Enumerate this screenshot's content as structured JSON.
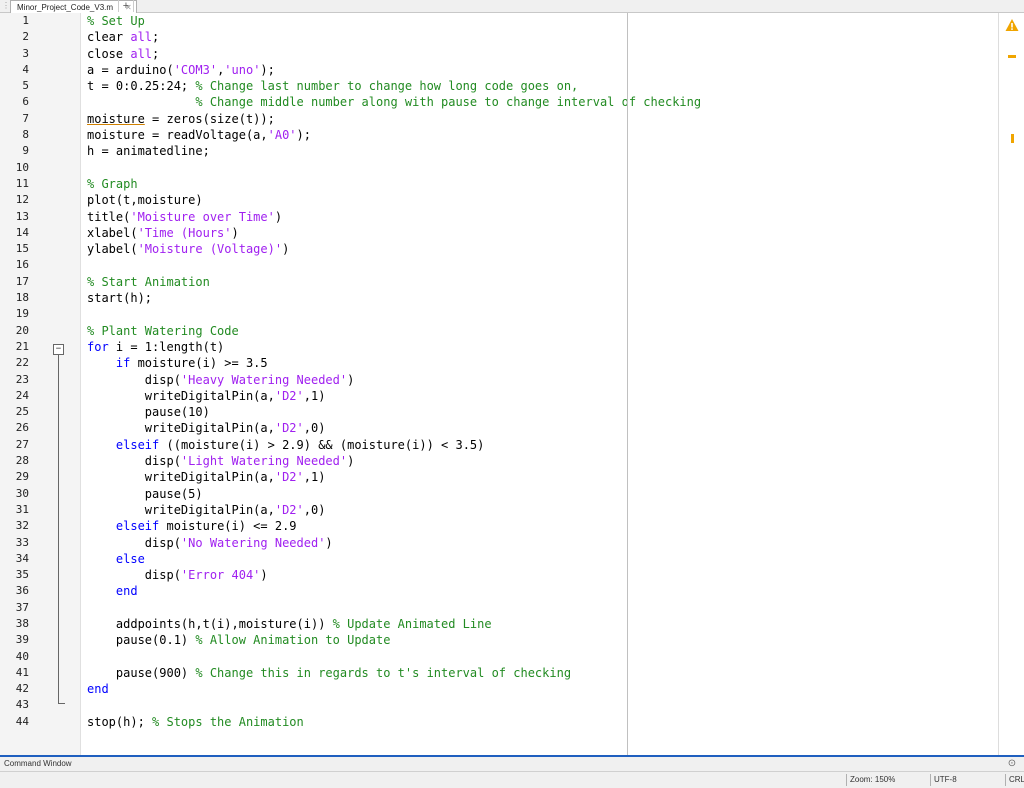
{
  "tab": {
    "title": "Minor_Project_Code_V3.m",
    "close": "✕",
    "add": "+"
  },
  "lines": [
    {
      "n": "1",
      "segs": [
        {
          "t": "% Set Up",
          "c": "cm"
        }
      ]
    },
    {
      "n": "2",
      "segs": [
        {
          "t": "clear ",
          "c": ""
        },
        {
          "t": "all",
          "c": "str"
        },
        {
          "t": ";",
          "c": ""
        }
      ]
    },
    {
      "n": "3",
      "segs": [
        {
          "t": "close ",
          "c": ""
        },
        {
          "t": "all",
          "c": "str"
        },
        {
          "t": ";",
          "c": ""
        }
      ]
    },
    {
      "n": "4",
      "segs": [
        {
          "t": "a = arduino(",
          "c": ""
        },
        {
          "t": "'COM3'",
          "c": "str"
        },
        {
          "t": ",",
          "c": ""
        },
        {
          "t": "'uno'",
          "c": "str"
        },
        {
          "t": ");",
          "c": ""
        }
      ]
    },
    {
      "n": "5",
      "segs": [
        {
          "t": "t = 0:0.25:24; ",
          "c": ""
        },
        {
          "t": "% Change last number to change how long code goes on,",
          "c": "cm"
        }
      ]
    },
    {
      "n": "6",
      "segs": [
        {
          "t": "               ",
          "c": ""
        },
        {
          "t": "% Change middle number along with pause to change interval of checking",
          "c": "cm"
        }
      ]
    },
    {
      "n": "7",
      "segs": [
        {
          "t": "moisture",
          "c": "ul"
        },
        {
          "t": " = zeros(size(t));",
          "c": ""
        }
      ]
    },
    {
      "n": "8",
      "segs": [
        {
          "t": "moisture = readVoltage(a,",
          "c": ""
        },
        {
          "t": "'A0'",
          "c": "str"
        },
        {
          "t": ");",
          "c": ""
        }
      ]
    },
    {
      "n": "9",
      "segs": [
        {
          "t": "h = animatedline;",
          "c": ""
        }
      ]
    },
    {
      "n": "10",
      "segs": []
    },
    {
      "n": "11",
      "segs": [
        {
          "t": "% Graph",
          "c": "cm"
        }
      ]
    },
    {
      "n": "12",
      "segs": [
        {
          "t": "plot(t,moisture)",
          "c": ""
        }
      ]
    },
    {
      "n": "13",
      "segs": [
        {
          "t": "title(",
          "c": ""
        },
        {
          "t": "'Moisture over Time'",
          "c": "str"
        },
        {
          "t": ")",
          "c": ""
        }
      ]
    },
    {
      "n": "14",
      "segs": [
        {
          "t": "xlabel(",
          "c": ""
        },
        {
          "t": "'Time (Hours'",
          "c": "str"
        },
        {
          "t": ")",
          "c": ""
        }
      ]
    },
    {
      "n": "15",
      "segs": [
        {
          "t": "ylabel(",
          "c": ""
        },
        {
          "t": "'Moisture (Voltage)'",
          "c": "str"
        },
        {
          "t": ")",
          "c": ""
        }
      ]
    },
    {
      "n": "16",
      "segs": []
    },
    {
      "n": "17",
      "segs": [
        {
          "t": "% Start Animation",
          "c": "cm"
        }
      ]
    },
    {
      "n": "18",
      "segs": [
        {
          "t": "start(h);",
          "c": ""
        }
      ]
    },
    {
      "n": "19",
      "segs": []
    },
    {
      "n": "20",
      "segs": [
        {
          "t": "% Plant Watering Code",
          "c": "cm"
        }
      ]
    },
    {
      "n": "21",
      "segs": [
        {
          "t": "for",
          "c": "kw"
        },
        {
          "t": " i = 1:length(t)",
          "c": ""
        }
      ]
    },
    {
      "n": "22",
      "segs": [
        {
          "t": "    ",
          "c": ""
        },
        {
          "t": "if",
          "c": "kw"
        },
        {
          "t": " moisture(i) >= 3.5",
          "c": ""
        }
      ]
    },
    {
      "n": "23",
      "segs": [
        {
          "t": "        disp(",
          "c": ""
        },
        {
          "t": "'Heavy Watering Needed'",
          "c": "str"
        },
        {
          "t": ")",
          "c": ""
        }
      ]
    },
    {
      "n": "24",
      "segs": [
        {
          "t": "        writeDigitalPin(a,",
          "c": ""
        },
        {
          "t": "'D2'",
          "c": "str"
        },
        {
          "t": ",1)",
          "c": ""
        }
      ]
    },
    {
      "n": "25",
      "segs": [
        {
          "t": "        pause(10)",
          "c": ""
        }
      ]
    },
    {
      "n": "26",
      "segs": [
        {
          "t": "        writeDigitalPin(a,",
          "c": ""
        },
        {
          "t": "'D2'",
          "c": "str"
        },
        {
          "t": ",0)",
          "c": ""
        }
      ]
    },
    {
      "n": "27",
      "segs": [
        {
          "t": "    ",
          "c": ""
        },
        {
          "t": "elseif",
          "c": "kw"
        },
        {
          "t": " ((moisture(i) > 2.9) && (moisture(i)) < 3.5)",
          "c": ""
        }
      ]
    },
    {
      "n": "28",
      "segs": [
        {
          "t": "        disp(",
          "c": ""
        },
        {
          "t": "'Light Watering Needed'",
          "c": "str"
        },
        {
          "t": ")",
          "c": ""
        }
      ]
    },
    {
      "n": "29",
      "segs": [
        {
          "t": "        writeDigitalPin(a,",
          "c": ""
        },
        {
          "t": "'D2'",
          "c": "str"
        },
        {
          "t": ",1)",
          "c": ""
        }
      ]
    },
    {
      "n": "30",
      "segs": [
        {
          "t": "        pause(5)",
          "c": ""
        }
      ]
    },
    {
      "n": "31",
      "segs": [
        {
          "t": "        writeDigitalPin(a,",
          "c": ""
        },
        {
          "t": "'D2'",
          "c": "str"
        },
        {
          "t": ",0)",
          "c": ""
        }
      ]
    },
    {
      "n": "32",
      "segs": [
        {
          "t": "    ",
          "c": ""
        },
        {
          "t": "elseif",
          "c": "kw"
        },
        {
          "t": " moisture(i) <= 2.9",
          "c": ""
        }
      ]
    },
    {
      "n": "33",
      "segs": [
        {
          "t": "        disp(",
          "c": ""
        },
        {
          "t": "'No Watering Needed'",
          "c": "str"
        },
        {
          "t": ")",
          "c": ""
        }
      ]
    },
    {
      "n": "34",
      "segs": [
        {
          "t": "    ",
          "c": ""
        },
        {
          "t": "else",
          "c": "kw"
        }
      ]
    },
    {
      "n": "35",
      "segs": [
        {
          "t": "        disp(",
          "c": ""
        },
        {
          "t": "'Error 404'",
          "c": "str"
        },
        {
          "t": ")",
          "c": ""
        }
      ]
    },
    {
      "n": "36",
      "segs": [
        {
          "t": "    ",
          "c": ""
        },
        {
          "t": "end",
          "c": "kw"
        }
      ]
    },
    {
      "n": "37",
      "segs": []
    },
    {
      "n": "38",
      "segs": [
        {
          "t": "    addpoints(h,t(i),moisture(i)) ",
          "c": ""
        },
        {
          "t": "% Update Animated Line",
          "c": "cm"
        }
      ]
    },
    {
      "n": "39",
      "segs": [
        {
          "t": "    pause(0.1) ",
          "c": ""
        },
        {
          "t": "% Allow Animation to Update",
          "c": "cm"
        }
      ]
    },
    {
      "n": "40",
      "segs": []
    },
    {
      "n": "41",
      "segs": [
        {
          "t": "    pause(900) ",
          "c": ""
        },
        {
          "t": "% Change this in regards to t's interval of checking",
          "c": "cm"
        }
      ]
    },
    {
      "n": "42",
      "segs": [
        {
          "t": "end",
          "c": "kw"
        }
      ]
    },
    {
      "n": "43",
      "segs": []
    },
    {
      "n": "44",
      "segs": [
        {
          "t": "stop(h); ",
          "c": ""
        },
        {
          "t": "% Stops the Animation",
          "c": "cm"
        }
      ]
    }
  ],
  "fold_toggle": "−",
  "warning_icon": "warning-triangle-icon",
  "colors": {
    "comment": "#228B22",
    "keyword": "#0000FF",
    "string": "#A020F0",
    "warning": "#F0A500",
    "accent": "#1F5FBF"
  },
  "command_window": {
    "title": "Command Window",
    "expand": "⊙"
  },
  "status": {
    "zoom": "Zoom: 150%",
    "encoding": "UTF-8",
    "eol": "CRLF"
  }
}
